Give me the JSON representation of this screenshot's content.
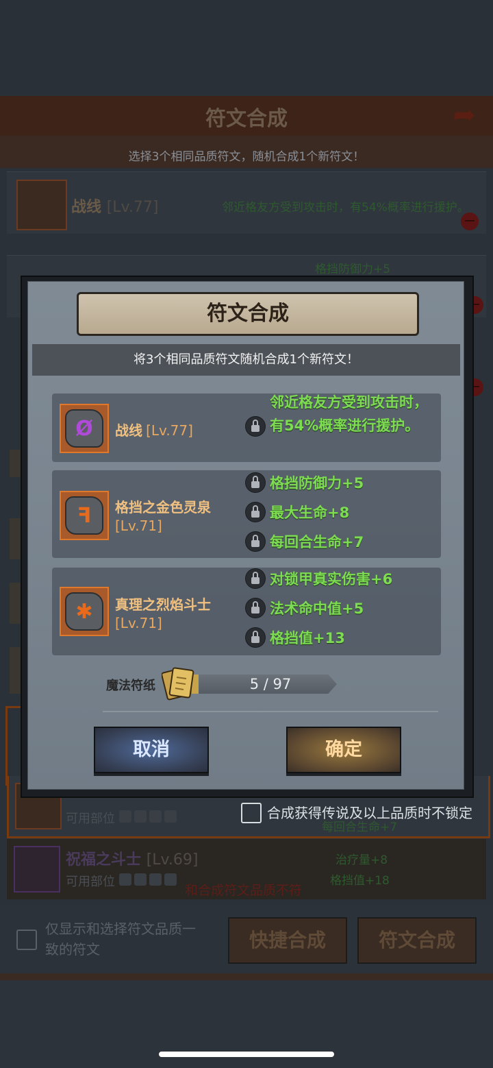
{
  "background": {
    "title": "符文合成",
    "subtitle": "选择3个相同品质符文，随机合成1个新符文！",
    "first_row": {
      "name": "战线",
      "level": "[Lv.77]",
      "effect": "邻近格友方受到攻击时，有54%概率进行援护。"
    },
    "second_row_effect": "格挡防御力+5",
    "row_a": {
      "available_label": "可用部位",
      "effect": "每回合生命+7"
    },
    "row_b": {
      "name": "祝福之斗士",
      "level": "[Lv.69]",
      "available_label": "可用部位",
      "effects": [
        "治疗量+8",
        "格挡值+18"
      ],
      "warning": "和合成符文品质不符"
    },
    "unlock_checkbox_label": "合成获得传说及以上品质时不锁定",
    "filter_checkbox_label_line1": "仅显示和选择符文品质一",
    "filter_checkbox_label_line2": "致的符文",
    "quick_compose_button": "快捷合成",
    "rune_compose_button": "符文合成"
  },
  "modal": {
    "title": "符文合成",
    "subtitle": "将3个相同品质符文随机合成1个新符文！",
    "runes": [
      {
        "name": "战线",
        "level": "[Lv.77]",
        "glyph": "Ø",
        "glyph_color": "#b04ad8",
        "effects": [
          "邻近格友方受到攻击时，",
          "有54%概率进行援护。"
        ]
      },
      {
        "name": "格挡之金色灵泉",
        "level": "[Lv.71]",
        "glyph": "ꟻ",
        "glyph_color": "#e86a1a",
        "effects": [
          "格挡防御力+5",
          "最大生命+8",
          "每回合生命+7"
        ]
      },
      {
        "name": "真理之烈焰斗士",
        "level": "[Lv.71]",
        "glyph": "✱",
        "glyph_color": "#e86a1a",
        "effects": [
          "对锁甲真实伤害+6",
          "法术命中值+5",
          "格挡值+13"
        ]
      }
    ],
    "paper_label": "魔法符纸",
    "paper_progress_text": "5 / 97",
    "paper_progress_fraction": 0.0515,
    "cancel_button": "取消",
    "confirm_button": "确定"
  }
}
